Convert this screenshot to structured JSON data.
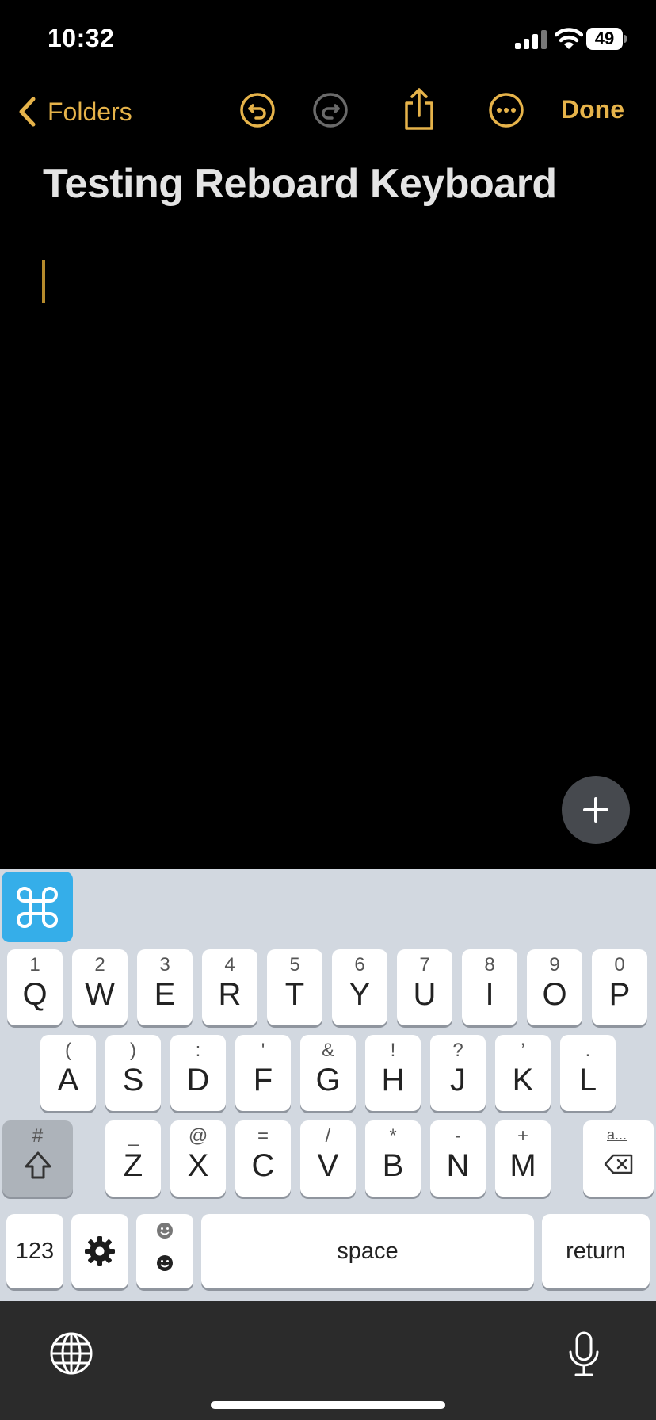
{
  "status_bar": {
    "time": "10:32",
    "battery": "49"
  },
  "nav": {
    "back_label": "Folders",
    "done_label": "Done"
  },
  "note": {
    "title": "Testing Reboard Keyboard"
  },
  "keyboard": {
    "row1": [
      {
        "sec": "1",
        "pri": "Q"
      },
      {
        "sec": "2",
        "pri": "W"
      },
      {
        "sec": "3",
        "pri": "E"
      },
      {
        "sec": "4",
        "pri": "R"
      },
      {
        "sec": "5",
        "pri": "T"
      },
      {
        "sec": "6",
        "pri": "Y"
      },
      {
        "sec": "7",
        "pri": "U"
      },
      {
        "sec": "8",
        "pri": "I"
      },
      {
        "sec": "9",
        "pri": "O"
      },
      {
        "sec": "0",
        "pri": "P"
      }
    ],
    "row2": [
      {
        "sec": "(",
        "pri": "A"
      },
      {
        "sec": ")",
        "pri": "S"
      },
      {
        "sec": ":",
        "pri": "D"
      },
      {
        "sec": "'",
        "pri": "F"
      },
      {
        "sec": "&",
        "pri": "G"
      },
      {
        "sec": "!",
        "pri": "H"
      },
      {
        "sec": "?",
        "pri": "J"
      },
      {
        "sec": "’",
        "pri": "K"
      },
      {
        "sec": ".",
        "pri": "L"
      }
    ],
    "row3": [
      {
        "sec": "_",
        "pri": "Z"
      },
      {
        "sec": "@",
        "pri": "X"
      },
      {
        "sec": "=",
        "pri": "C"
      },
      {
        "sec": "/",
        "pri": "V"
      },
      {
        "sec": "*",
        "pri": "B"
      },
      {
        "sec": "-",
        "pri": "N"
      },
      {
        "sec": "+",
        "pri": "M"
      }
    ],
    "shift_secondary": "#",
    "delete_secondary": "a...",
    "numbers_label": "123",
    "space_label": "space",
    "return_label": "return"
  },
  "colors": {
    "accent": "#e6b34a",
    "command_key": "#35aee9",
    "keyboard_bg": "#d2d8e0"
  }
}
